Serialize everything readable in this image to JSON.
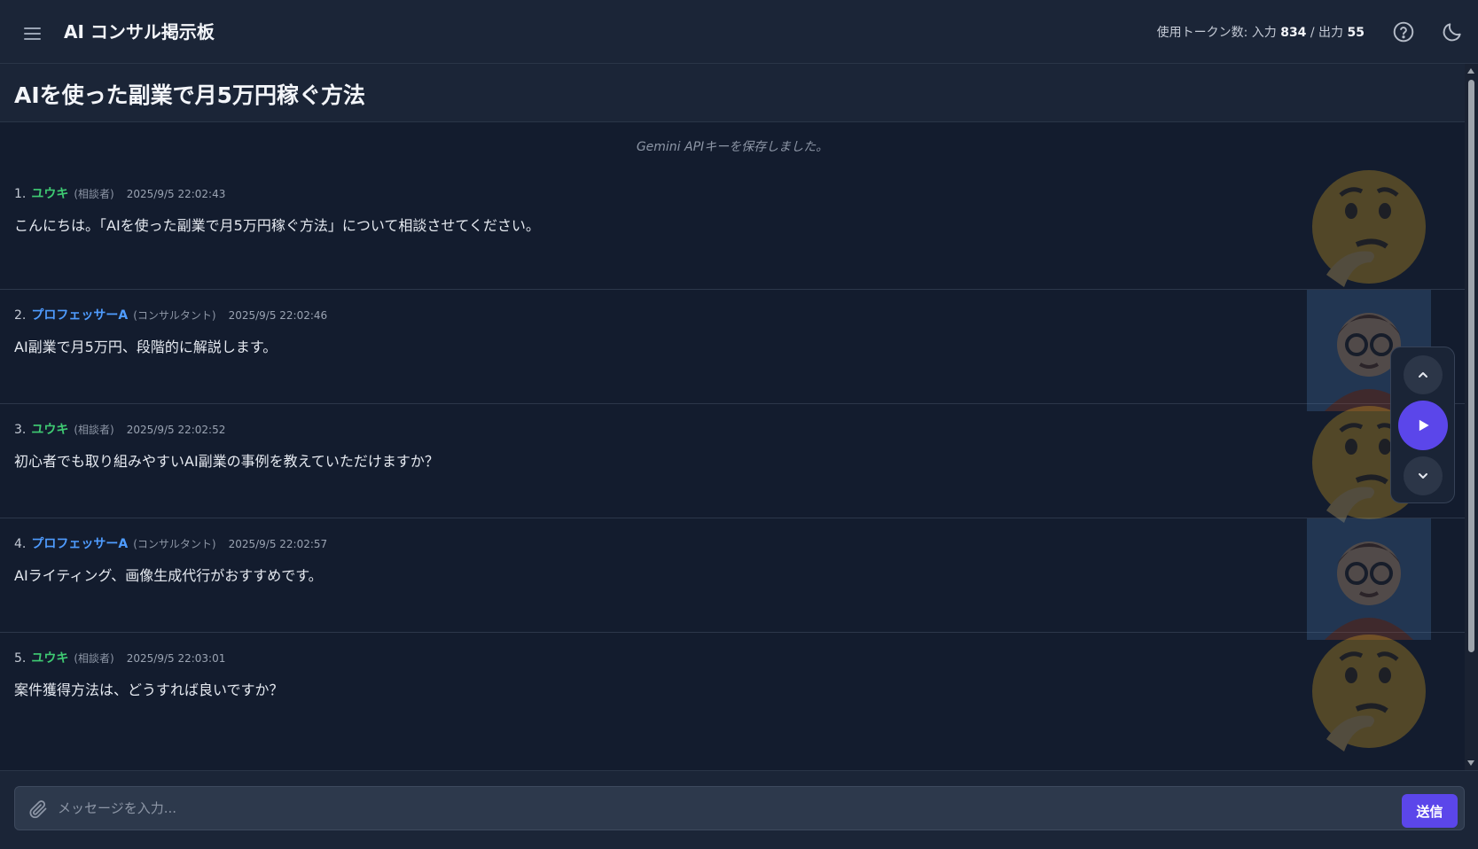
{
  "header": {
    "app_title": "AI コンサル掲示板",
    "token_prefix": "使用トークン数: 入力",
    "input_tokens": "834",
    "separator": "/ 出力",
    "output_tokens": "55",
    "icons": {
      "menu": "menu-icon",
      "help": "help-circle-icon",
      "theme": "moon-icon"
    }
  },
  "thread": {
    "title": "AIを使った副業で月5万円稼ぐ方法"
  },
  "system_note": "Gemini APIキーを保存しました。",
  "messages": [
    {
      "num": "1.",
      "author": "ユウキ",
      "role": "(相談者)",
      "time": "2025/9/5 22:02:43",
      "text": "こんにちは。「AIを使った副業で月5万円稼ぐ方法」について相談させてください。",
      "avatar": "thinking-face-emoji"
    },
    {
      "num": "2.",
      "author": "プロフェッサーA",
      "role": "(コンサルタント)",
      "time": "2025/9/5 22:02:46",
      "text": "AI副業で月5万円、段階的に解説します。",
      "avatar": "professor-avatar"
    },
    {
      "num": "3.",
      "author": "ユウキ",
      "role": "(相談者)",
      "time": "2025/9/5 22:02:52",
      "text": "初心者でも取り組みやすいAI副業の事例を教えていただけますか？",
      "avatar": "thinking-face-emoji"
    },
    {
      "num": "4.",
      "author": "プロフェッサーA",
      "role": "(コンサルタント)",
      "time": "2025/9/5 22:02:57",
      "text": "AIライティング、画像生成代行がおすすめです。",
      "avatar": "professor-avatar"
    },
    {
      "num": "5.",
      "author": "ユウキ",
      "role": "(相談者)",
      "time": "2025/9/5 22:03:01",
      "text": "案件獲得方法は、どうすれば良いですか？",
      "avatar": "thinking-face-emoji"
    }
  ],
  "controls": {
    "up": "chevron-up-icon",
    "play": "play-icon",
    "down": "chevron-down-icon"
  },
  "composer": {
    "placeholder": "メッセージを入力...",
    "send_label": "送信",
    "attach_icon": "paperclip-icon"
  },
  "colors": {
    "accent": "#5b46ea",
    "consultee": "#3fcb73",
    "consultant": "#4f9cff",
    "background": "#131c2e"
  }
}
